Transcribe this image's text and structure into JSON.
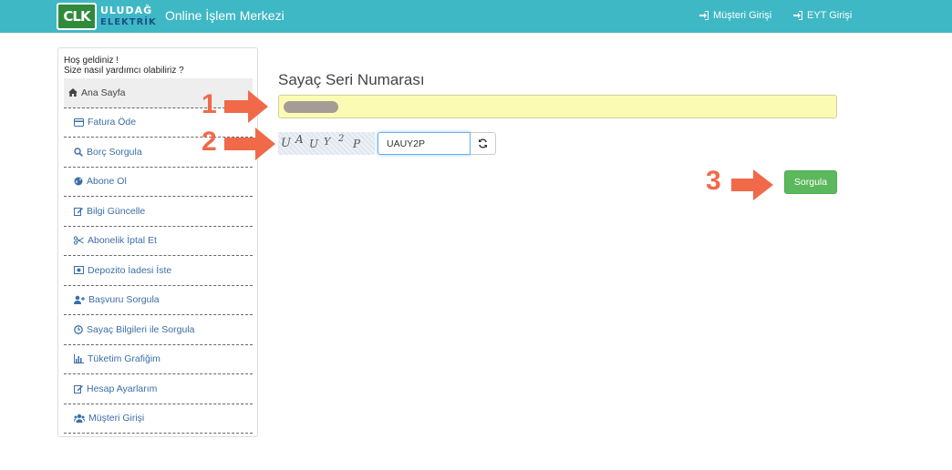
{
  "header": {
    "logo_mark": "CLK",
    "logo_line1": "ULUDAĞ",
    "logo_line2": "ELEKTRİK",
    "title": "Online İşlem Merkezi",
    "links": [
      {
        "label": "Müşteri Girişi",
        "icon": "sign-in-icon"
      },
      {
        "label": "EYT Girişi",
        "icon": "sign-in-icon"
      }
    ]
  },
  "sidebar": {
    "greeting_line1": "Hoş geldiniz !",
    "greeting_line2": "Size nasıl yardımcı olabiliriz ?",
    "items": [
      {
        "label": "Ana Sayfa",
        "icon": "home-icon",
        "active": true
      },
      {
        "label": "Fatura Öde",
        "icon": "credit-card-icon"
      },
      {
        "label": "Borç Sorgula",
        "icon": "search-icon"
      },
      {
        "label": "Abone Ol",
        "icon": "globe-icon"
      },
      {
        "label": "Bilgi Güncelle",
        "icon": "edit-icon"
      },
      {
        "label": "Abonelik İptal Et",
        "icon": "scissors-icon"
      },
      {
        "label": "Depozito İadesi İste",
        "icon": "money-icon"
      },
      {
        "label": "Başvuru Sorgula",
        "icon": "user-plus-icon"
      },
      {
        "label": "Sayaç Bilgileri ile Sorgula",
        "icon": "clock-icon"
      },
      {
        "label": "Tüketim Grafiğim",
        "icon": "bar-chart-icon"
      },
      {
        "label": "Hesap Ayarlarım",
        "icon": "edit-icon"
      },
      {
        "label": "Müşteri Girişi",
        "icon": "users-icon"
      }
    ]
  },
  "main": {
    "title": "Sayaç Seri Numarası",
    "serial_value": "",
    "captcha_text": "UAUY2P",
    "captcha_value": "UAUY2P",
    "refresh_icon": "refresh-icon",
    "submit_label": "Sorgula"
  },
  "annotations": {
    "step1": "1",
    "step2": "2",
    "step3": "3",
    "color": "#f06a4a"
  },
  "colors": {
    "topbar": "#3fb8c5",
    "link": "#3b6ea8",
    "submit": "#5cb85c",
    "serial_field": "#fbfbb4"
  }
}
